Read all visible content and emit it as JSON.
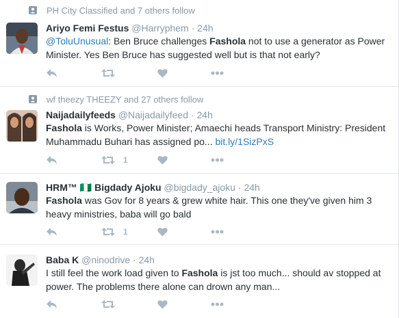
{
  "colors": {
    "name": "#292f33",
    "muted": "#8899a6",
    "link": "#2b7bb9",
    "action": "#aab8c2",
    "divider": "#e1e8ed"
  },
  "tweets": [
    {
      "context": "PH City Classified and 7 others follow",
      "name": "Ariyo Femi Festus",
      "handle": "@Harryphem",
      "dot": "·",
      "time": "24h",
      "text": {
        "mention": "@ToluUnusual",
        "p1": ": Ben Bruce challenges ",
        "bold": "Fashola",
        "p2": " not to use a generator as Power Minister. Yes Ben Bruce has suggested well but is that not early?"
      },
      "retweets": ""
    },
    {
      "context": "wf theezy THEEZY and 27 others follow",
      "name": "Naijadailyfeeds",
      "handle": "@Naijadailyfeed",
      "dot": "·",
      "time": "24h",
      "text": {
        "bold": "Fashola",
        "p1": " is Works, Power Minister; Amaechi heads Transport Ministry: President Muhammadu Buhari has assigned po... ",
        "link": "bit.ly/1SizPxS"
      },
      "retweets": "1"
    },
    {
      "name": "HRM™ 🇳🇬 Bigdady Ajoku",
      "handle": "@bigdady_ajoku",
      "dot": "·",
      "time": "24h",
      "text": {
        "bold": "Fashola",
        "p1": " was Gov for 8 years & grew white hair. This one they've given him 3 heavy ministries, baba will go bald"
      },
      "retweets": "1"
    },
    {
      "name": "Baba K",
      "handle": "@ninodrive",
      "dot": "·",
      "time": "24h",
      "text": {
        "p1": "I still feel the work load given to ",
        "bold": "Fashola",
        "p2": " is jst too much... should av stopped at power. The problems there alone can drown any man..."
      },
      "retweets": ""
    }
  ]
}
